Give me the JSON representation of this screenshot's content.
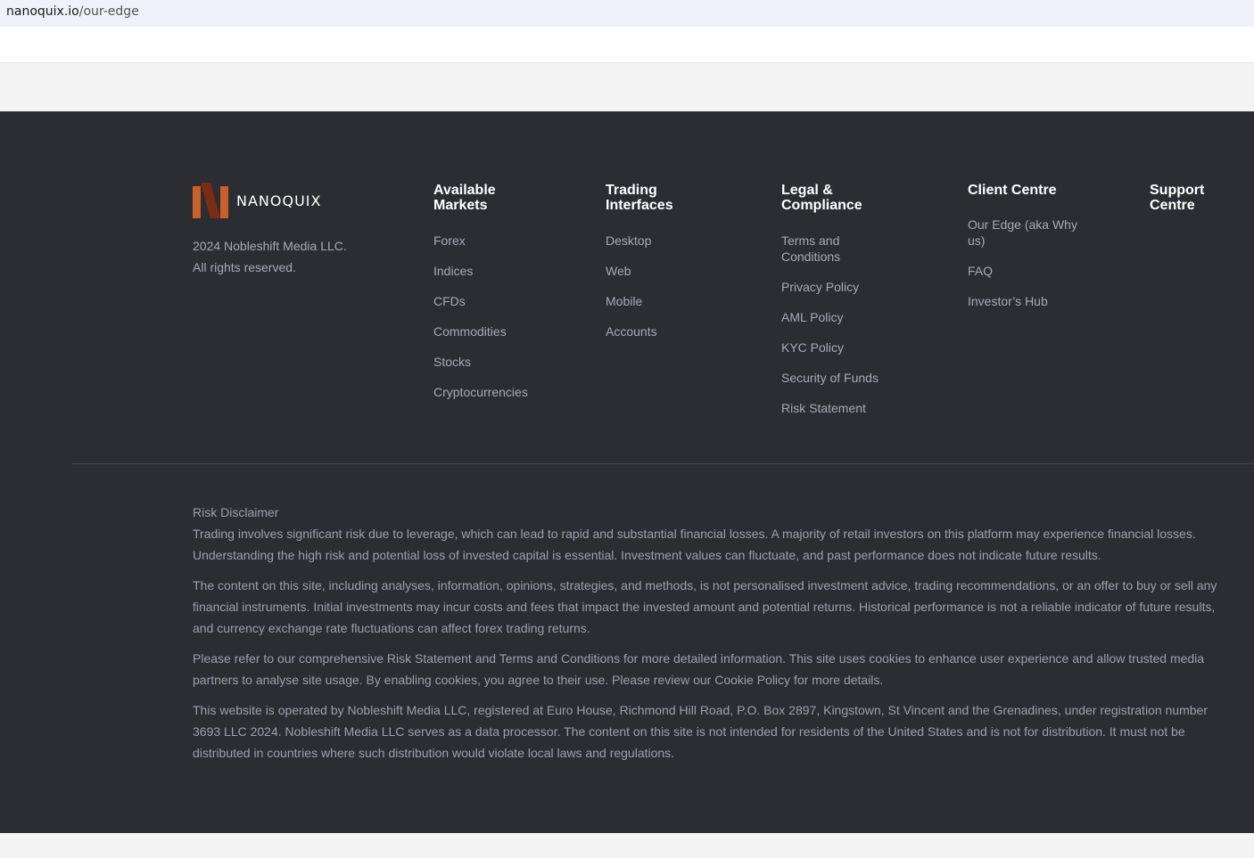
{
  "browser": {
    "url_domain": "nanoquix.io",
    "url_path": "/our-edge"
  },
  "brand": {
    "name": "NANOQUIX",
    "logo_colors": [
      "#c9602b",
      "#7a2d12"
    ],
    "copyright_line1": "2024 Nobleshift Media LLC.",
    "copyright_line2": "All rights reserved."
  },
  "columns": [
    {
      "heading": "Available Markets",
      "links": [
        "Forex",
        "Indices",
        "CFDs",
        "Commodities",
        "Stocks",
        "Cryptocurrencies"
      ]
    },
    {
      "heading": "Trading Interfaces",
      "links": [
        "Desktop",
        "Web",
        "Mobile",
        "Accounts"
      ]
    },
    {
      "heading": "Legal & Compliance",
      "links": [
        "Terms and Conditions",
        "Privacy Policy",
        "AML Policy",
        "KYC Policy",
        "Security of Funds",
        "Risk Statement"
      ]
    },
    {
      "heading": "Client Centre",
      "links": [
        "Our Edge (aka Why us)",
        "FAQ",
        "Investor’s Hub"
      ]
    },
    {
      "heading": "Support Centre",
      "links": []
    }
  ],
  "disclaimer": {
    "title": "Risk Disclaimer",
    "p1": "Trading involves significant risk due to leverage, which can lead to rapid and substantial financial losses. A majority of retail investors on this platform may experience financial losses. Understanding the high risk and potential loss of invested capital is essential. Investment values can fluctuate, and past performance does not indicate future results.",
    "p2": "The content on this site, including analyses, information, opinions, strategies, and methods, is not personalised investment advice, trading recommendations, or an offer to buy or sell any financial instruments. Initial investments may incur costs and fees that impact the invested amount and potential returns. Historical performance is not a reliable indicator of future results, and currency exchange rate fluctuations can affect forex trading returns.",
    "p3": "Please refer to our comprehensive Risk Statement and Terms and Conditions for more detailed information. This site uses cookies to enhance user experience and allow trusted media partners to analyse site usage. By enabling cookies, you agree to their use. Please review our Cookie Policy for more details.",
    "p4": "This website is operated by Nobleshift Media LLC, registered at Euro House, Richmond Hill Road, P.O. Box 2897, Kingstown, St Vincent and the Grenadines, under registration number 3693 LLC 2024. Nobleshift Media LLC serves as a data processor. The content on this site is not intended for residents of the United States and is not for distribution. It must not be distributed in countries where such distribution would violate local laws and regulations."
  },
  "colors": {
    "footer_bg": "#2b2d33",
    "heading": "#ffffff",
    "link": "#a7aab1"
  }
}
